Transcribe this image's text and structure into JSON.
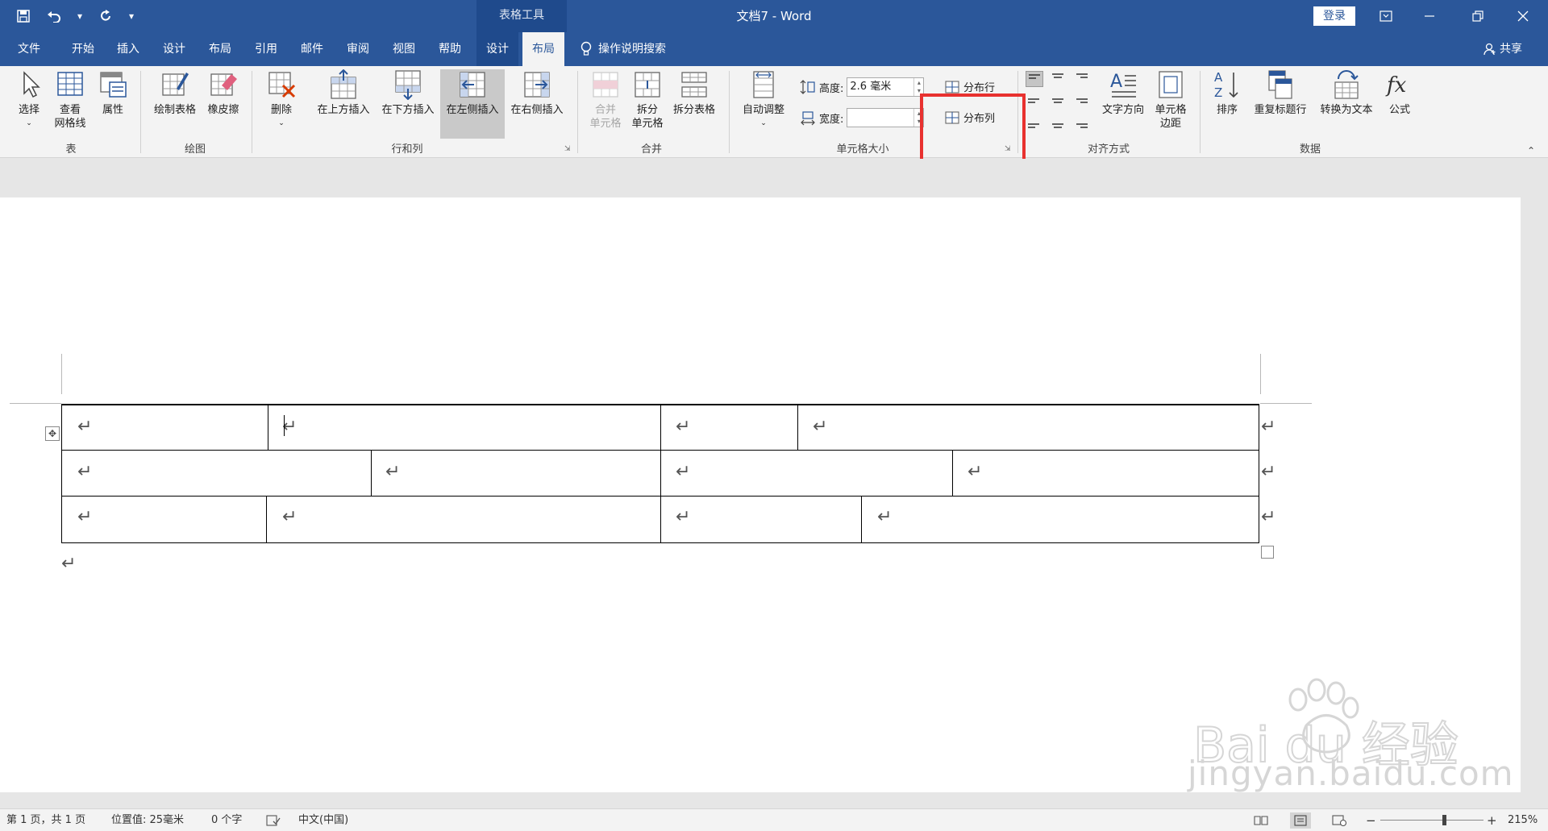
{
  "titlebar": {
    "context_group": "表格工具",
    "doc_title": "文档7 - Word",
    "login": "登录"
  },
  "tabs": [
    {
      "label": "文件"
    },
    {
      "label": "开始"
    },
    {
      "label": "插入"
    },
    {
      "label": "设计"
    },
    {
      "label": "布局"
    },
    {
      "label": "引用"
    },
    {
      "label": "邮件"
    },
    {
      "label": "审阅"
    },
    {
      "label": "视图"
    },
    {
      "label": "帮助"
    },
    {
      "label": "设计"
    },
    {
      "label": "布局"
    }
  ],
  "tell_me": "操作说明搜索",
  "share": "共享",
  "ribbon": {
    "table_group": {
      "select": "选择",
      "gridlines_1": "查看",
      "gridlines_2": "网格线",
      "properties": "属性",
      "label": "表"
    },
    "draw_group": {
      "draw_table": "绘制表格",
      "eraser": "橡皮擦",
      "label": "绘图"
    },
    "rows_cols_group": {
      "delete": "删除",
      "insert_above": "在上方插入",
      "insert_below": "在下方插入",
      "insert_left": "在左侧插入",
      "insert_right": "在右侧插入",
      "label": "行和列"
    },
    "merge_group": {
      "merge_1": "合并",
      "merge_2": "单元格",
      "split_1": "拆分",
      "split_2": "单元格",
      "split_table": "拆分表格",
      "label": "合并"
    },
    "cell_size_group": {
      "autofit": "自动调整",
      "height_label": "高度:",
      "height_value": "2.6 毫米",
      "width_label": "宽度:",
      "width_value": "",
      "distribute_rows": "分布行",
      "distribute_cols": "分布列",
      "label": "单元格大小"
    },
    "alignment_group": {
      "text_direction": "文字方向",
      "margins_1": "单元格",
      "margins_2": "边距",
      "label": "对齐方式"
    },
    "data_group": {
      "sort": "排序",
      "repeat_header": "重复标题行",
      "convert": "转换为文本",
      "formula": "公式",
      "label": "数据"
    }
  },
  "document": {
    "para_mark": "↵",
    "move_handle": "✥"
  },
  "statusbar": {
    "page": "第 1 页，共 1 页",
    "position": "位置值: 25毫米",
    "words": "0 个字",
    "language": "中文(中国)",
    "zoom": "215%"
  },
  "watermark": {
    "brand": "Bai du 经验",
    "url": "jingyan.baidu.com"
  },
  "colors": {
    "title_bar": "#2b579a",
    "context_tab": "#1f4a8c",
    "highlight": "#e8312f"
  }
}
